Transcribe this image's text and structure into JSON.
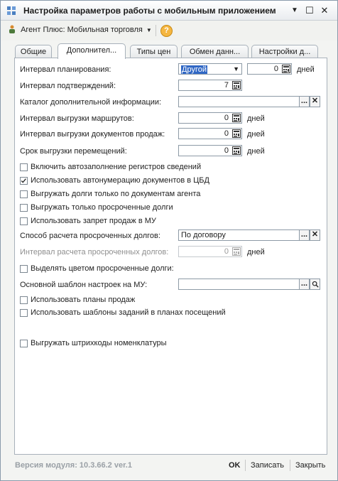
{
  "window": {
    "title": "Настройка параметров работы с мобильным приложением",
    "controls": {
      "minimize": "▼",
      "maximize": "☐",
      "close": "✕"
    }
  },
  "toolbar": {
    "agent_button": "Агент Плюс: Мобильная торговля",
    "help": "?"
  },
  "tabs": [
    {
      "label": "Общие",
      "active": false
    },
    {
      "label": "Дополнител...",
      "active": true
    },
    {
      "label": "Типы цен",
      "active": false
    },
    {
      "label": "Обмен данн...",
      "active": false
    },
    {
      "label": "Настройки д...",
      "active": false
    }
  ],
  "form": {
    "planning_label": "Интервал планирования:",
    "planning_type": "Другой",
    "planning_value": "0",
    "planning_unit": "дней",
    "confirm_label": "Интервал подтверждений:",
    "confirm_value": "7",
    "catalog_label": "Каталог дополнительной информации:",
    "catalog_value": "",
    "routes_label": "Интервал выгрузки маршрутов:",
    "routes_value": "0",
    "routes_unit": "дней",
    "docs_label": "Интервал выгрузки документов продаж:",
    "docs_value": "0",
    "docs_unit": "дней",
    "moves_label": "Срок выгрузки перемещений:",
    "moves_value": "0",
    "moves_unit": "дней",
    "cb_autofill": "Включить автозаполнение регистров сведений",
    "cb_autonum": "Использовать автонумерацию документов в ЦБД",
    "cb_debts_agent": "Выгружать долги только по документам агента",
    "cb_debts_overdue": "Выгружать только просроченные долги",
    "cb_sales_ban": "Использовать запрет продаж в МУ",
    "calc_label": "Способ расчета просроченных долгов:",
    "calc_value": "По договору",
    "calc_interval_label": "Интервал расчета просроченных долгов:",
    "calc_interval_value": "0",
    "calc_interval_unit": "дней",
    "cb_highlight": "Выделять цветом просроченные долги:",
    "template_label": "Основной шаблон настроек на МУ:",
    "template_value": "",
    "cb_sales_plans": "Использовать планы продаж",
    "cb_task_templates": "Использовать шаблоны заданий в планах посещений",
    "cb_barcodes": "Выгружать штрихкоды номенклатуры",
    "buttons": {
      "dots": "...",
      "clear": "✕"
    }
  },
  "footer": {
    "version": "Версия модуля:  10.3.66.2 ver.1",
    "ok": "OK",
    "save": "Записать",
    "close": "Закрыть"
  }
}
